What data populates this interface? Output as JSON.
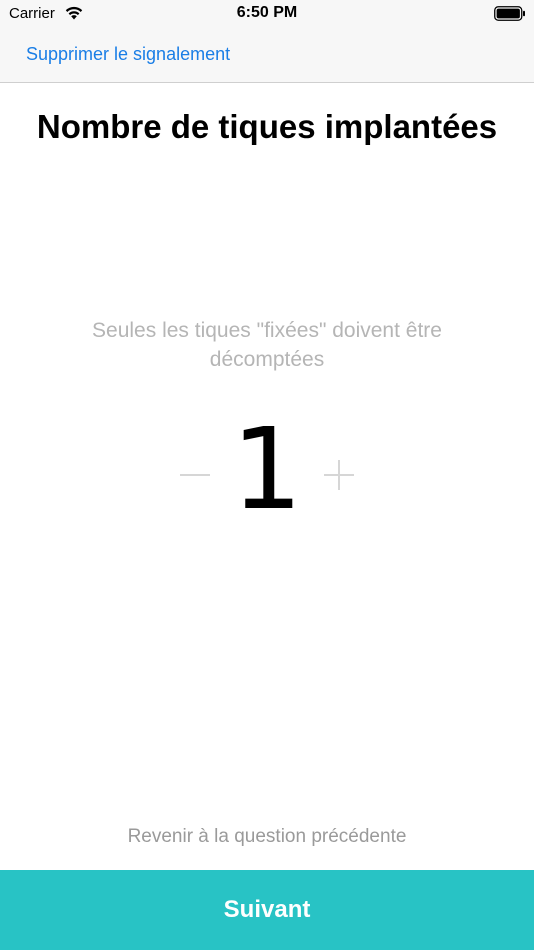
{
  "status_bar": {
    "carrier": "Carrier",
    "time": "6:50 PM",
    "wifi_icon": "wifi-icon",
    "battery_icon": "battery-icon"
  },
  "nav": {
    "delete_report": "Supprimer le signalement",
    "link_color": "#1a7ee6"
  },
  "question": {
    "title": "Nombre de tiques implantées",
    "hint": "Seules les tiques \"fixées\" doivent être décomptées"
  },
  "stepper": {
    "value": "1",
    "minus_icon": "minus-icon",
    "plus_icon": "plus-icon"
  },
  "footer": {
    "previous_question": "Revenir à la question précédente",
    "next_label": "Suivant",
    "next_color": "#28c3c5"
  }
}
